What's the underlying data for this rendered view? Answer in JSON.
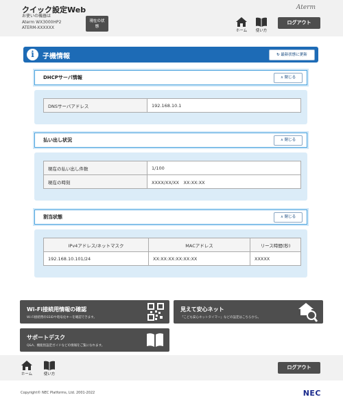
{
  "header": {
    "title": "クイック設定Web",
    "device_lines": [
      "お使いの機器は",
      "Aterm WX3000HP2",
      "ATERM-XXXXXX"
    ],
    "status_button": "現在の状態",
    "brand": "Aterm",
    "home_label": "ホーム",
    "help_label": "使い方",
    "logout_label": "ログアウト"
  },
  "section": {
    "title": "子機情報",
    "refresh_label": "最新状態に更新"
  },
  "groups": {
    "dhcp": {
      "title": "DHCPサーバ情報",
      "close_label": "閉じる",
      "rows": [
        {
          "key": "DNSサーバアドレス",
          "value": "192.168.10.1"
        }
      ]
    },
    "lease_out": {
      "title": "払い出し状況",
      "close_label": "閉じる",
      "rows": [
        {
          "key": "現在の払い出し件数",
          "value": "1/100"
        },
        {
          "key": "現在の時刻",
          "value": "XXXX/XX/XX　XX:XX:XX"
        }
      ]
    },
    "assignment": {
      "title": "割当状態",
      "close_label": "閉じる",
      "columns": [
        "IPv4アドレス/ネットマスク",
        "MACアドレス",
        "リース時間(秒)"
      ],
      "rows": [
        [
          "192.168.10.101/24",
          "XX:XX:XX:XX:XX:XX",
          "XXXXX"
        ]
      ]
    }
  },
  "tiles": {
    "wifi": {
      "title": "Wi-Fi接続用情報の確認",
      "desc": "Wi-Fi接続用のSSIDや暗号化キーを確認できます。",
      "icon": "qr-code-icon"
    },
    "safety": {
      "title": "見えて安心ネット",
      "desc": "「こども安心ネットタイマー」などの設定はこちらから。",
      "icon": "house-search-icon"
    },
    "support": {
      "title": "サポートデスク",
      "desc": "Q&A、機能別設定ガイドなどの情報をご覧になれます。",
      "icon": "book-icon"
    }
  },
  "footer": {
    "home_label": "ホーム",
    "help_label": "使い方",
    "logout_label": "ログアウト",
    "copyright": "Copyright© NEC Platforms, Ltd. 2001-2022",
    "logo": "NEC"
  },
  "colors": {
    "accent": "#1d6bb6",
    "dark_button": "#4e4e4e",
    "panel": "#dbecf8"
  }
}
